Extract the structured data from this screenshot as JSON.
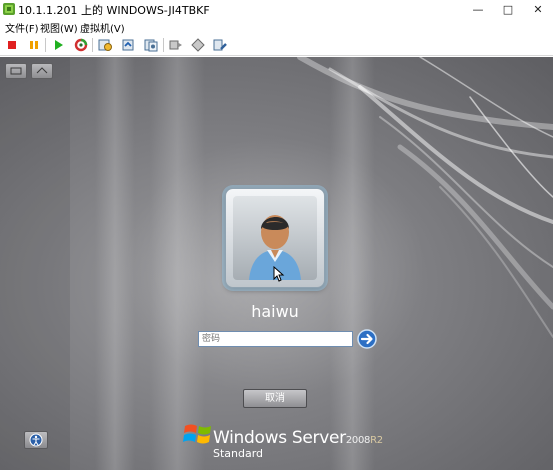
{
  "window": {
    "title": "10.1.1.201 上的 WINDOWS-JI4TBKF",
    "minimize_glyph": "—",
    "maximize_glyph": "□",
    "close_glyph": "✕"
  },
  "menu": {
    "items": [
      {
        "label": "文件(F)"
      },
      {
        "label": "视图(W)"
      },
      {
        "label": "虚拟机(V)"
      }
    ]
  },
  "toolbar": {
    "buttons": [
      {
        "icon": "stop-icon"
      },
      {
        "icon": "pause-icon"
      },
      {
        "icon": "play-icon"
      },
      {
        "icon": "reset-icon"
      },
      {
        "icon": "snapshot-icon"
      },
      {
        "icon": "revert-snapshot-icon"
      },
      {
        "icon": "manage-snapshots-icon"
      },
      {
        "icon": "send-keys-icon"
      },
      {
        "icon": "ctrl-alt-del-icon"
      },
      {
        "icon": "settings-icon"
      }
    ],
    "colors": {
      "stop": "#e02020",
      "pause": "#f0a000",
      "play": "#20b020"
    }
  },
  "login": {
    "username": "haiwu",
    "password_placeholder": "密码",
    "cancel_label": "取消"
  },
  "branding": {
    "name": "Windows Server",
    "version": "2008",
    "release": "R2",
    "edition": "Standard"
  }
}
